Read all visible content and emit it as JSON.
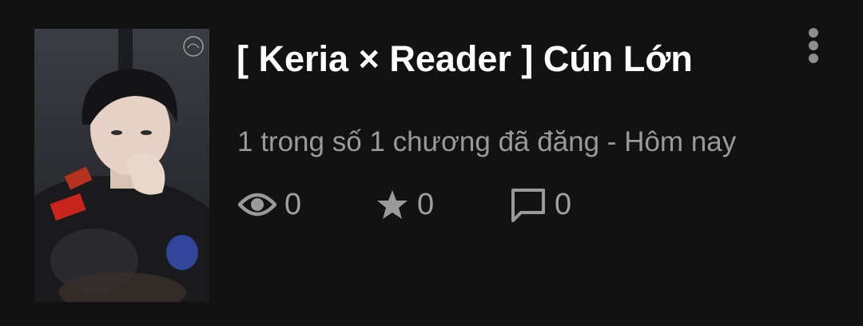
{
  "story": {
    "title": "[ Keria × Reader ] Cún Lớn",
    "subtitle": "1 trong số 1 chương đã đăng - Hôm nay",
    "cover": {
      "description_icon": "cover-image"
    },
    "menu_icon": "more-vertical-icon"
  },
  "stats": {
    "views": {
      "icon": "eye-icon",
      "value": "0"
    },
    "votes": {
      "icon": "star-icon",
      "value": "0"
    },
    "comments": {
      "icon": "comment-icon",
      "value": "0"
    }
  },
  "colors": {
    "background": "#121212",
    "title": "#ffffff",
    "secondary": "#9a9a9a",
    "icon": "#9a9a9a"
  }
}
